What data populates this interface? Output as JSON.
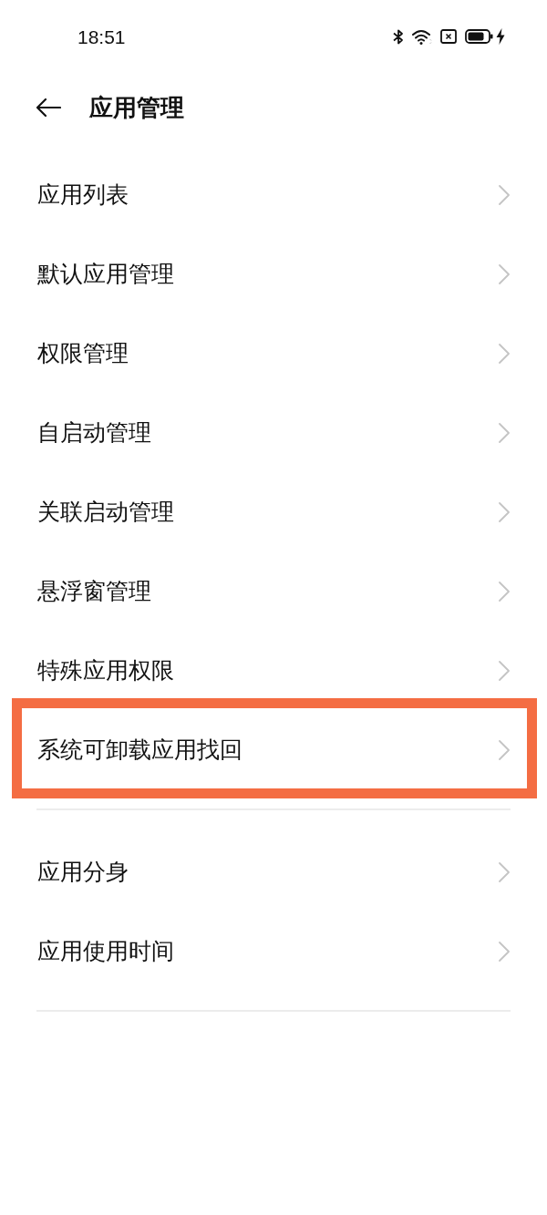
{
  "status_bar": {
    "time": "18:51"
  },
  "header": {
    "title": "应用管理"
  },
  "groups": [
    {
      "items": [
        {
          "label": "应用列表",
          "highlighted": false
        },
        {
          "label": "默认应用管理",
          "highlighted": false
        },
        {
          "label": "权限管理",
          "highlighted": false
        },
        {
          "label": "自启动管理",
          "highlighted": false
        },
        {
          "label": "关联启动管理",
          "highlighted": false
        },
        {
          "label": "悬浮窗管理",
          "highlighted": false
        },
        {
          "label": "特殊应用权限",
          "highlighted": false
        },
        {
          "label": "系统可卸载应用找回",
          "highlighted": true
        }
      ]
    },
    {
      "items": [
        {
          "label": "应用分身",
          "highlighted": false
        },
        {
          "label": "应用使用时间",
          "highlighted": false
        }
      ]
    }
  ]
}
